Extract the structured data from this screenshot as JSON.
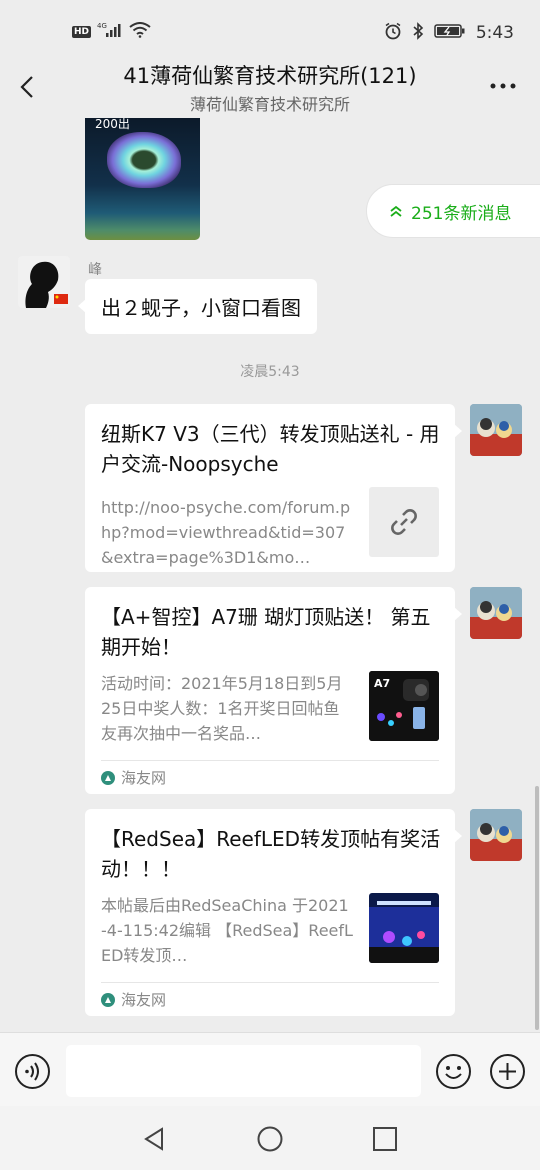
{
  "status_bar": {
    "hd": "HD",
    "network": "4G",
    "time": "5:43"
  },
  "header": {
    "title": "41薄荷仙繁育技术研究所(121)",
    "subtitle": "薄荷仙繁育技术研究所"
  },
  "chat": {
    "image_caption": "200出",
    "new_messages": "251条新消息",
    "sender_name": "峰",
    "text_message": "出２蚬子，小窗口看图",
    "timestamp": "凌晨5:43",
    "cards": [
      {
        "title": "纽斯K7 V3（三代）转发顶贴送礼 - 用户交流-Noopsyche",
        "desc": "http://noo-psyche.com/forum.php?mod=viewthread&tid=307&extra=page%3D1&mo…",
        "thumb_icon": "link-icon"
      },
      {
        "title": "【A+智控】A7珊 瑚灯顶贴送！ 第五期开始！",
        "desc": "活动时间：2021年5月18日到5月25日中奖人数：1名开奖日回帖鱼友再次抽中一名奖品…",
        "thumb_label": "A7",
        "source": "海友网"
      },
      {
        "title": "【RedSea】ReefLED转发顶帖有奖活动！！！",
        "desc": "本帖最后由RedSeaChina 于2021-4-115:42编辑 【RedSea】ReefLED转发顶…",
        "source": "海友网"
      }
    ]
  },
  "input": {
    "placeholder": ""
  },
  "colors": {
    "background": "#ededed",
    "accent_green": "#1aad19",
    "bubble": "#ffffff"
  }
}
